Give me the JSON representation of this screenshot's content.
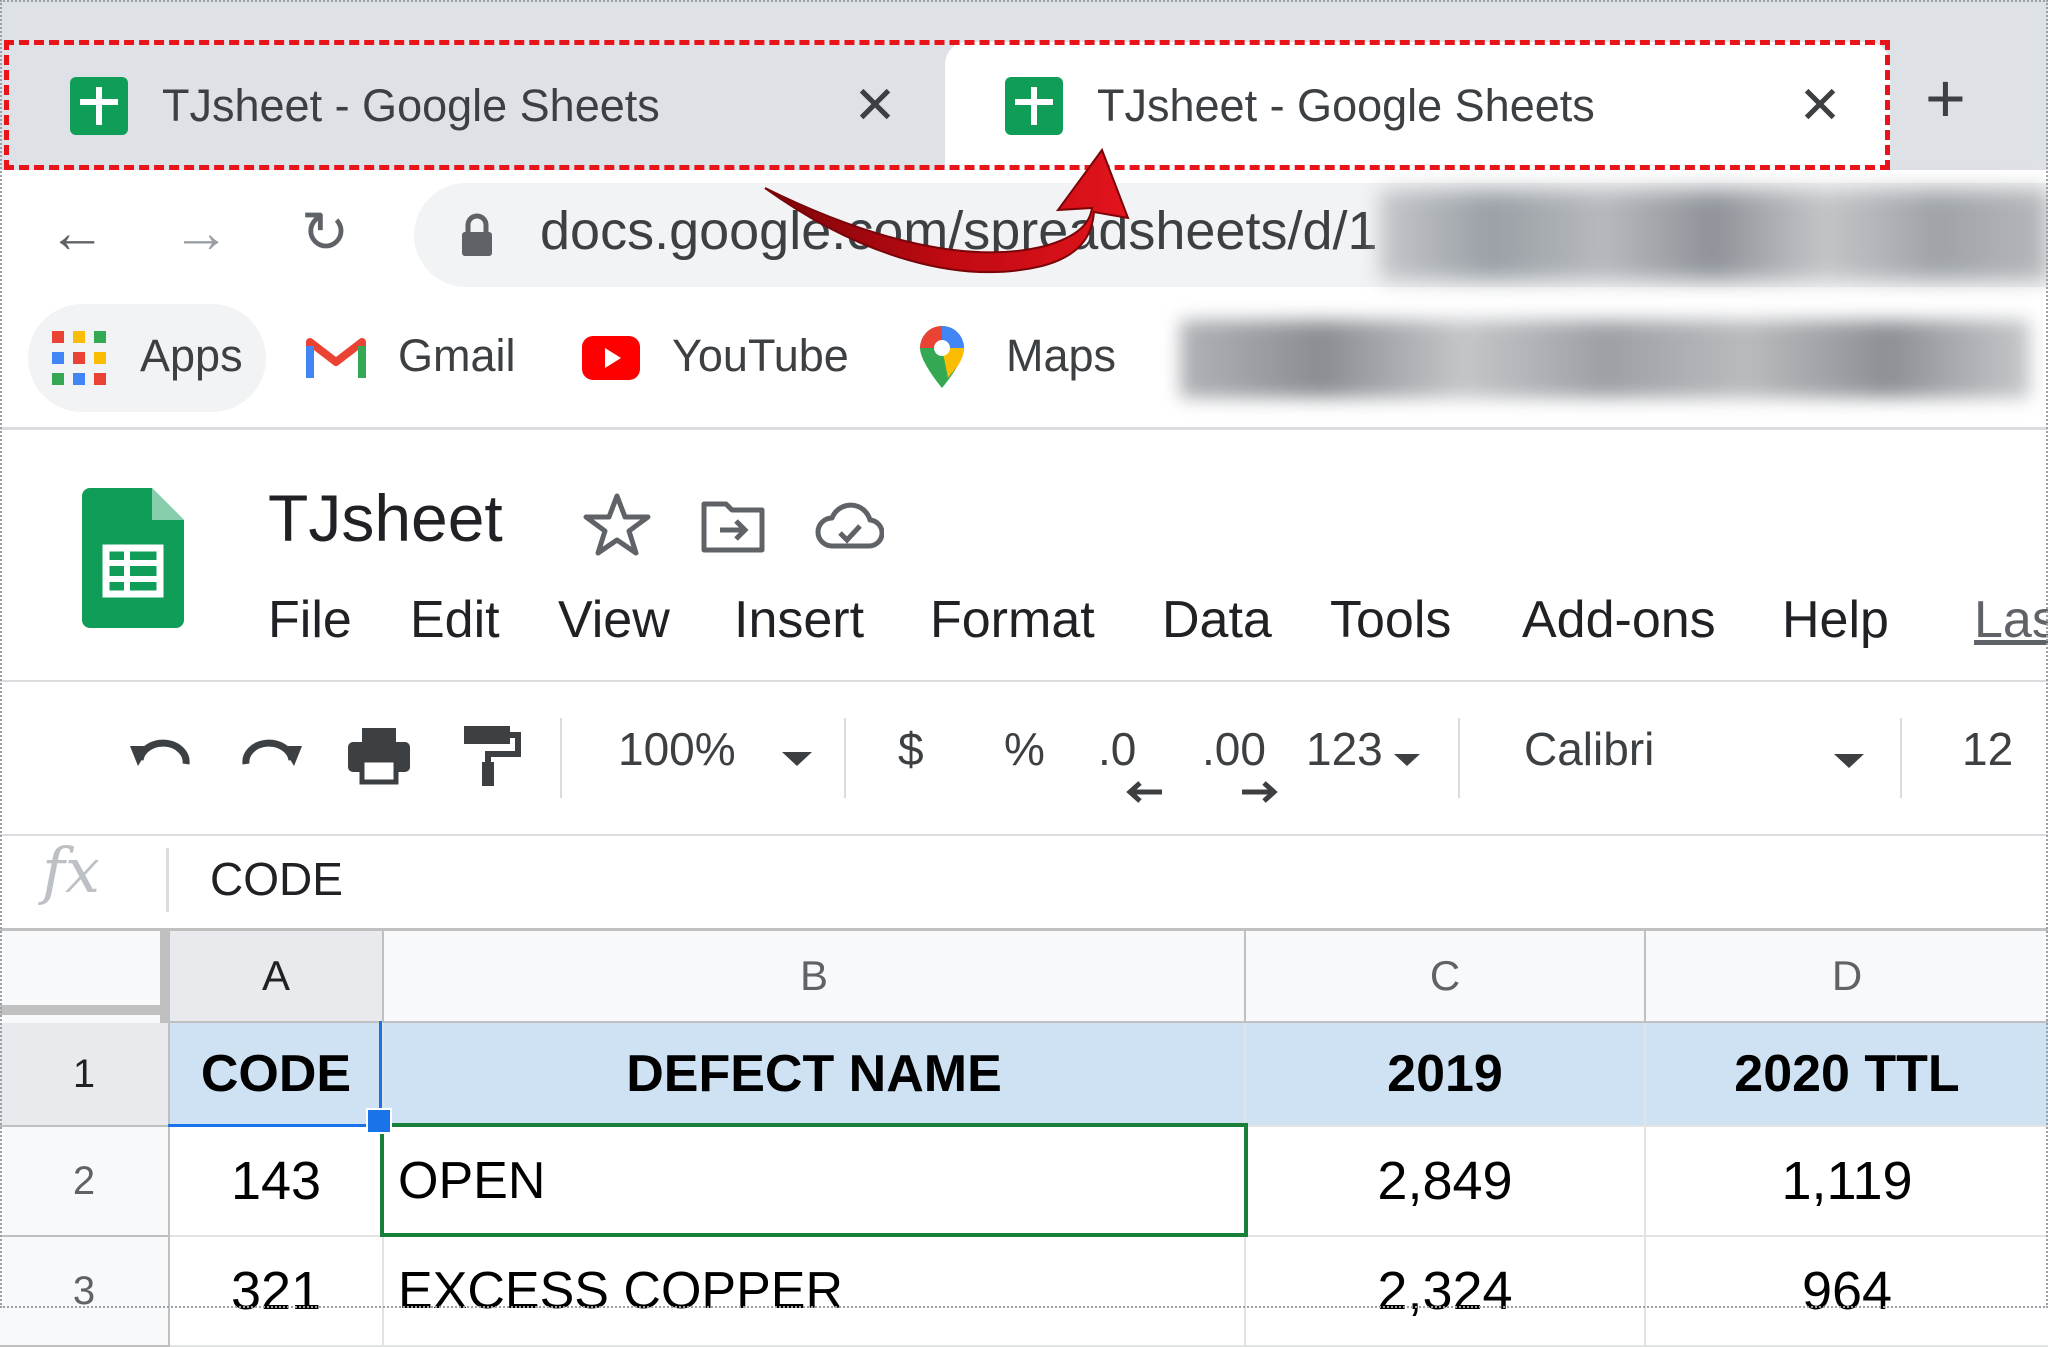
{
  "browser": {
    "tabs": [
      {
        "title": "TJsheet - Google Sheets",
        "close": "✕"
      },
      {
        "title": "TJsheet - Google Sheets",
        "close": "✕"
      }
    ],
    "new_tab": "+",
    "nav": {
      "back": "←",
      "forward": "→",
      "reload": "↻"
    },
    "url": "docs.google.com/spreadsheets/d/1",
    "bookmarks": [
      "Apps",
      "Gmail",
      "YouTube",
      "Maps"
    ]
  },
  "sheets": {
    "title": "TJsheet",
    "menu": [
      "File",
      "Edit",
      "View",
      "Insert",
      "Format",
      "Data",
      "Tools",
      "Add-ons",
      "Help"
    ],
    "menu_last": "Las",
    "toolbar": {
      "zoom": "100%",
      "currency": "$",
      "percent": "%",
      "dec_decrease": ".0",
      "dec_increase": ".00",
      "more_formats": "123",
      "font": "Calibri",
      "font_size": "12"
    },
    "formula_bar": {
      "fx": "fx",
      "content": "CODE"
    },
    "columns": [
      "A",
      "B",
      "C",
      "D"
    ],
    "rows": [
      {
        "num": "1",
        "cells": [
          "CODE",
          "DEFECT NAME",
          "2019",
          "2020 TTL"
        ]
      },
      {
        "num": "2",
        "cells": [
          "143",
          "OPEN",
          "2,849",
          "1,119"
        ]
      },
      {
        "num": "3",
        "cells": [
          "321",
          "EXCESS COPPER",
          "2,324",
          "964"
        ]
      }
    ]
  },
  "colors": {
    "highlight": "#e8141a",
    "arrow": "#b3080e",
    "sheets_green": "#0f9d58",
    "header_fill": "#cfe2f3",
    "selection_blue": "#1a73e8",
    "selection_green": "#188038"
  },
  "icons": [
    "sheets-favicon",
    "close-icon",
    "plus-icon",
    "back-icon",
    "forward-icon",
    "reload-icon",
    "lock-icon",
    "apps-grid-icon",
    "gmail-icon",
    "youtube-icon",
    "maps-pin-icon",
    "sheets-logo",
    "star-icon",
    "move-folder-icon",
    "cloud-check-icon",
    "undo-icon",
    "redo-icon",
    "print-icon",
    "paint-format-icon",
    "dropdown-caret-icon",
    "annotation-arrow"
  ]
}
